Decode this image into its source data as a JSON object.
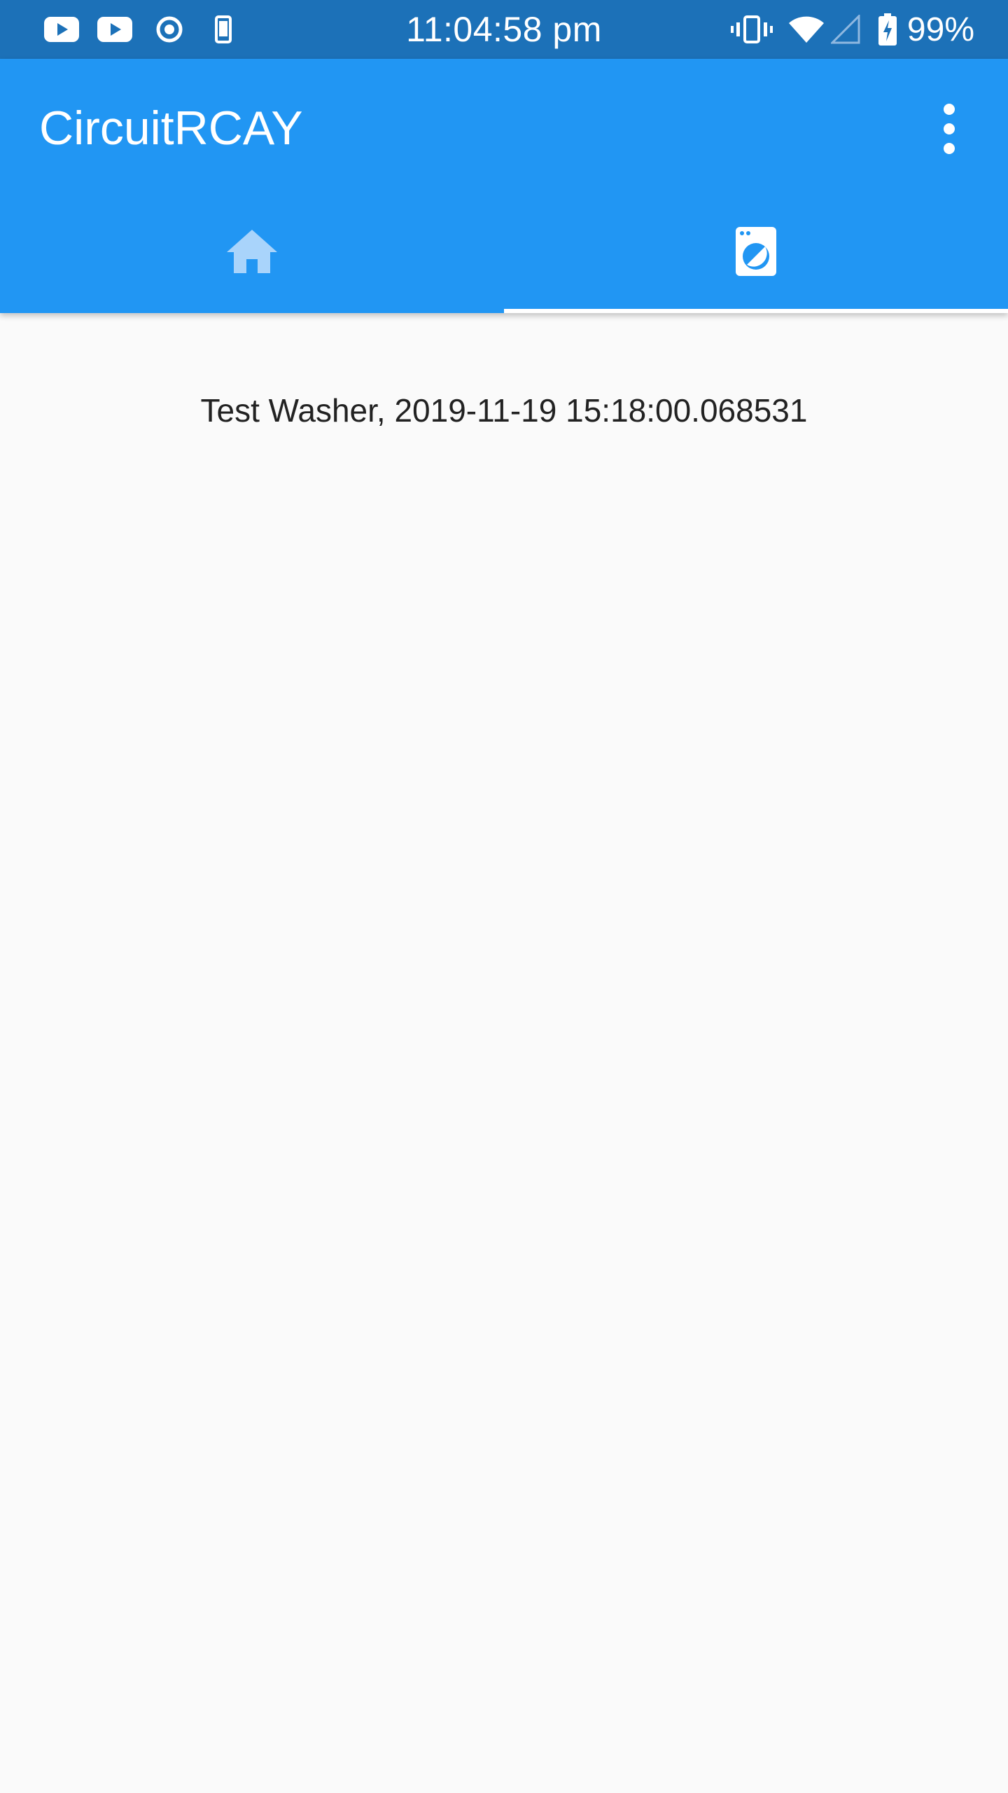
{
  "status_bar": {
    "time": "11:04:58 pm",
    "battery_percent": "99%",
    "left_icons": [
      "youtube-icon",
      "youtube-icon",
      "radio-button-icon",
      "phone-icon"
    ],
    "right_icons": [
      "vibrate-icon",
      "wifi-icon",
      "cellular-signal-icon",
      "battery-charging-icon"
    ]
  },
  "app_bar": {
    "title": "CircuitRCAY",
    "color": "#2196f3",
    "menu_icon": "more-vert-icon"
  },
  "tabs": [
    {
      "icon": "home-icon",
      "selected": false
    },
    {
      "icon": "washing-machine-icon",
      "selected": true
    }
  ],
  "content": {
    "record": "Test Washer, 2019-11-19 15:18:00.068531"
  }
}
